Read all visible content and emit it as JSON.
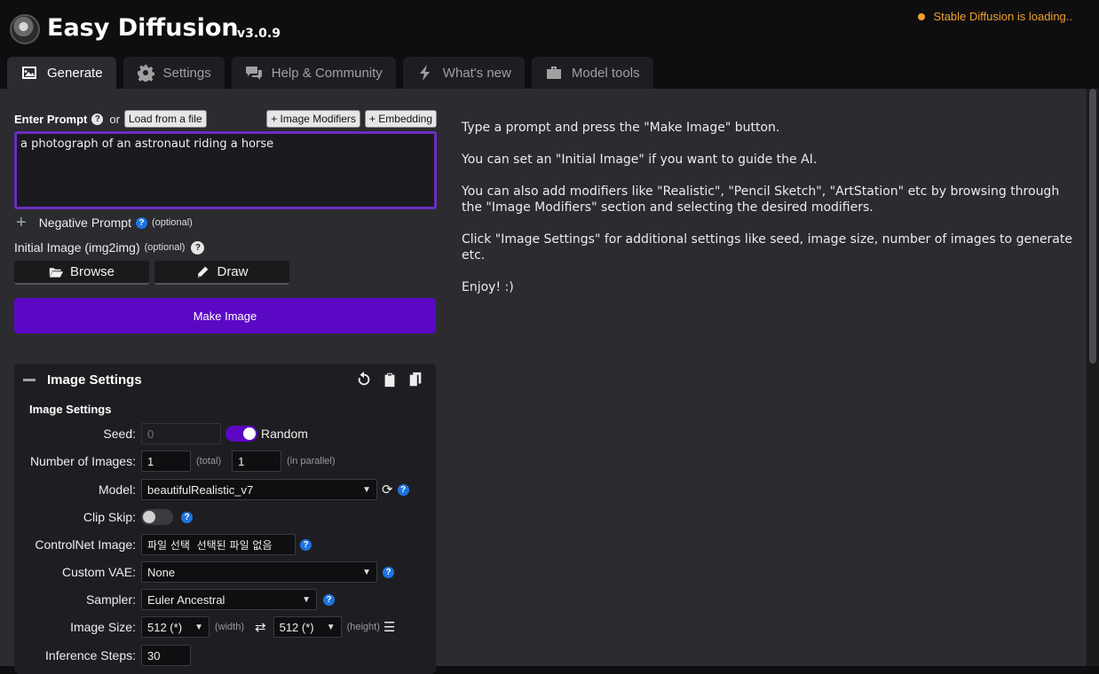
{
  "header": {
    "title": "Easy Diffusion",
    "version": "v3.0.9",
    "status": "Stable Diffusion is loading.."
  },
  "tabs": [
    {
      "label": "Generate",
      "icon": "image-icon",
      "active": true
    },
    {
      "label": "Settings",
      "icon": "gear-icon",
      "active": false
    },
    {
      "label": "Help & Community",
      "icon": "comments-icon",
      "active": false
    },
    {
      "label": "What's new",
      "icon": "bolt-icon",
      "active": false
    },
    {
      "label": "Model tools",
      "icon": "toolbox-icon",
      "active": false
    }
  ],
  "prompt": {
    "label": "Enter Prompt",
    "or": "or",
    "load_file": "Load from a file",
    "image_modifiers": "+ Image Modifiers",
    "embedding": "+ Embedding",
    "value": "a photograph of an astronaut riding a horse",
    "negative_label": "Negative Prompt",
    "optional": "(optional)",
    "initial_image_label": "Initial Image (img2img)",
    "browse": "Browse",
    "draw": "Draw",
    "make_image": "Make Image"
  },
  "image_settings": {
    "panel_title": "Image Settings",
    "sub_title": "Image Settings",
    "seed_label": "Seed:",
    "seed_value": "0",
    "random_label": "Random",
    "num_images_label": "Number of Images:",
    "num_total": "1",
    "total_hint": "(total)",
    "num_parallel": "1",
    "parallel_hint": "(in parallel)",
    "model_label": "Model:",
    "model_value": "beautifulRealistic_v7",
    "clip_skip_label": "Clip Skip:",
    "controlnet_label": "ControlNet Image:",
    "controlnet_value": "파일 선택  선택된 파일 없음",
    "vae_label": "Custom VAE:",
    "vae_value": "None",
    "sampler_label": "Sampler:",
    "sampler_value": "Euler Ancestral",
    "size_label": "Image Size:",
    "width_value": "512 (*)",
    "width_hint": "(width)",
    "height_value": "512 (*)",
    "height_hint": "(height)",
    "steps_label": "Inference Steps:",
    "steps_value": "30"
  },
  "help_text": [
    "Type a prompt and press the \"Make Image\" button.",
    "You can set an \"Initial Image\" if you want to guide the AI.",
    "You can also add modifiers like \"Realistic\", \"Pencil Sketch\", \"ArtStation\" etc by browsing through the \"Image Modifiers\" section and selecting the desired modifiers.",
    "Click \"Image Settings\" for additional settings like seed, image size, number of images to generate etc.",
    "Enjoy! :)"
  ],
  "colors": {
    "accent": "#5b08c5",
    "status": "#f0a030",
    "help_blue": "#1d74e0"
  }
}
